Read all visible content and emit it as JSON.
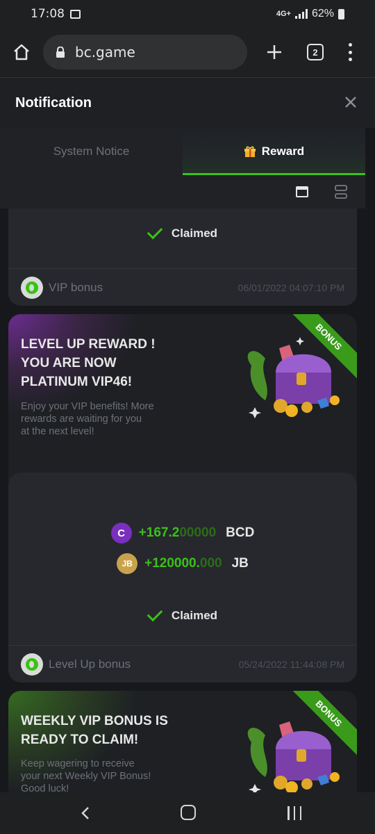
{
  "status_bar": {
    "time": "17:08",
    "network": "4G+",
    "battery": "62%"
  },
  "browser": {
    "url": "bc.game",
    "tab_count": "2"
  },
  "modal": {
    "title": "Notification",
    "tabs": [
      {
        "label": "System Notice",
        "active": false
      },
      {
        "label": "Reward",
        "active": true
      }
    ]
  },
  "cards": [
    {
      "claimed_label": "Claimed",
      "footer_label": "VIP bonus",
      "footer_date": "06/01/2022 04:07:10 PM"
    },
    {
      "ribbon": "BONUS",
      "title_line1": "LEVEL UP REWARD !",
      "title_line2": "YOU ARE NOW",
      "title_line3": "PLATINUM VIP46!",
      "desc_line1": "Enjoy your VIP benefits! More",
      "desc_line2": "rewards are waiting for you",
      "desc_line3": "at the next level!",
      "amounts": [
        {
          "coin": "C",
          "bright": "+167.2",
          "dim": "00000",
          "currency": "BCD"
        },
        {
          "coin": "JB",
          "bright": "+120000.",
          "dim": "000",
          "currency": "JB"
        }
      ],
      "claimed_label": "Claimed",
      "footer_label": "Level Up bonus",
      "footer_date": "05/24/2022 11:44:08 PM"
    },
    {
      "ribbon": "BONUS",
      "title_line1": "WEEKLY VIP BONUS IS",
      "title_line2": "READY TO CLAIM!",
      "desc_line1": "Keep wagering to receive",
      "desc_line2": "your next Weekly VIP Bonus!",
      "desc_line3": "Good luck!"
    }
  ],
  "colors": {
    "accent_green": "#3bc117",
    "card_bg": "#26282d",
    "purple": "#6b2d8e"
  }
}
